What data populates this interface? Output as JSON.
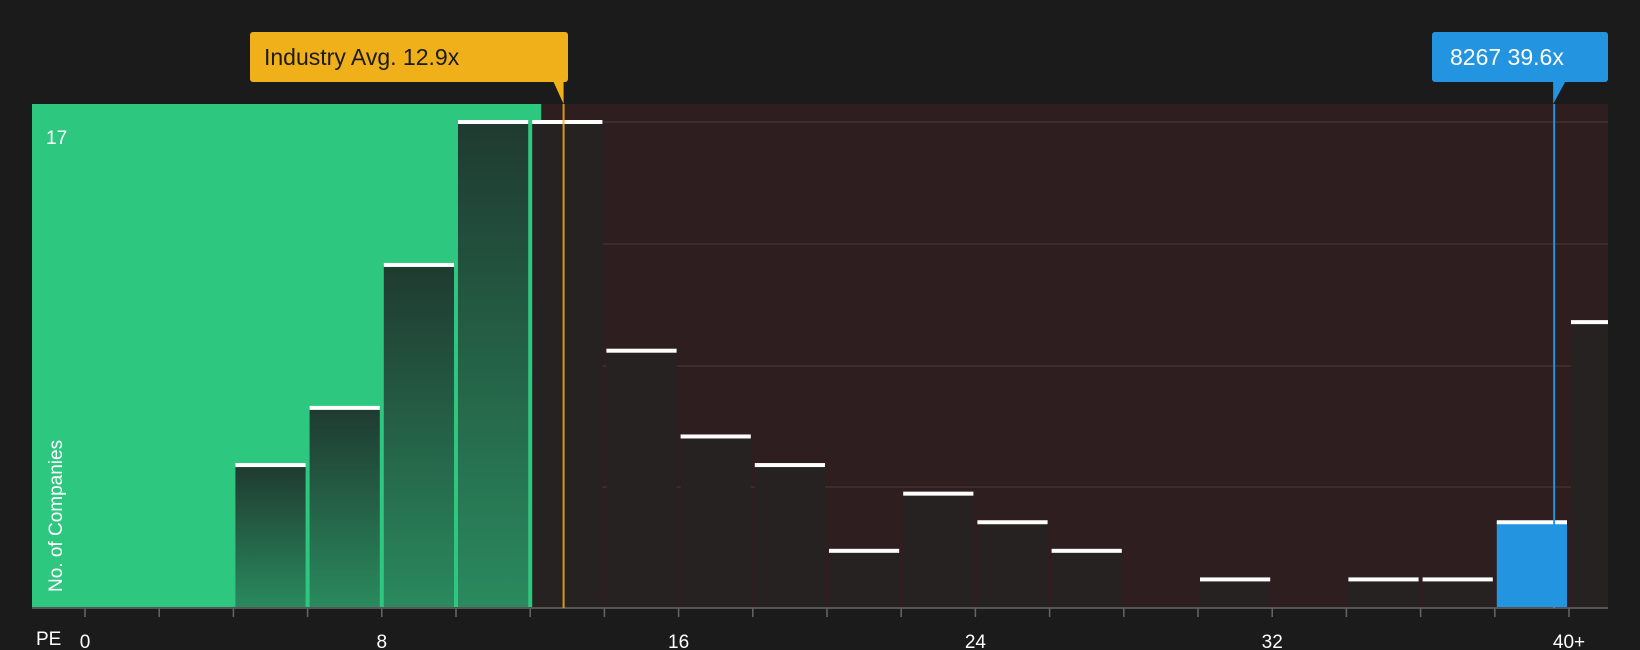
{
  "chart_data": {
    "type": "bar",
    "xlabel": "PE",
    "ylabel": "No. of Companies",
    "x_ticks": [
      "0",
      "8",
      "16",
      "24",
      "32",
      "40+"
    ],
    "y_max_label": "17",
    "ylim": [
      0,
      17
    ],
    "xlim": [
      -1.5,
      41.0
    ],
    "bin_width": 2,
    "bins": [
      {
        "start": 4,
        "count": 5
      },
      {
        "start": 6,
        "count": 7
      },
      {
        "start": 8,
        "count": 12
      },
      {
        "start": 10,
        "count": 17
      },
      {
        "start": 12,
        "count": 17
      },
      {
        "start": 14,
        "count": 9
      },
      {
        "start": 16,
        "count": 6
      },
      {
        "start": 18,
        "count": 5
      },
      {
        "start": 20,
        "count": 2
      },
      {
        "start": 22,
        "count": 4
      },
      {
        "start": 24,
        "count": 3
      },
      {
        "start": 26,
        "count": 2
      },
      {
        "start": 30,
        "count": 1
      },
      {
        "start": 34,
        "count": 1
      },
      {
        "start": 36,
        "count": 1
      },
      {
        "start": 38,
        "count": 3
      },
      {
        "start": 40,
        "count": 10
      }
    ],
    "highlight_bin_start": 38,
    "industry_avg": {
      "label": "Industry Avg. 12.9x",
      "value": 12.9
    },
    "company": {
      "label": "8267 39.6x",
      "value": 39.6
    },
    "colors": {
      "background": "#1b1b1b",
      "undervalued_zone": "#2ec780",
      "overvalued_zone": "#2e1e1f",
      "industry_avg": "#f0b019",
      "company": "#2394e0",
      "bar_dark": "#1f2a25",
      "bar_neutral": "#262222",
      "bar_top": "#ffffff"
    }
  }
}
